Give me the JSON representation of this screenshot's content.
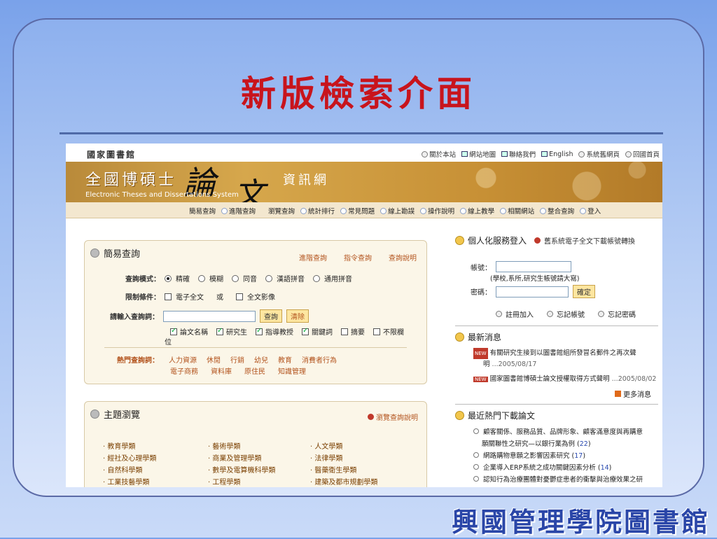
{
  "slide": {
    "title": "新版檢索介面",
    "footer_logo": "興國管理學院圖書館"
  },
  "site": {
    "library_name": "國家圖書館",
    "top_links": [
      "關於本站",
      "網站地圖",
      "聯絡我們",
      "English",
      "系統舊網頁",
      "回國首頁"
    ],
    "banner_title": "全國博碩士",
    "banner_big1": "論",
    "banner_big2": "文",
    "banner_sub": "資訊網",
    "banner_en": "Electronic Theses and Dissertations System",
    "nav": [
      "簡易查詢",
      "進階查詢",
      "瀏覽查詢",
      "統計排行",
      "常見問題",
      "線上勘誤",
      "操作說明",
      "線上教學",
      "相關網站",
      "整合查詢",
      "登入"
    ]
  },
  "simple_search": {
    "header": "簡易查詢",
    "links": [
      "進階查詢",
      "指令查詢",
      "查詢說明"
    ],
    "mode_label": "查詢模式：",
    "modes": [
      "精確",
      "模糊",
      "同音",
      "漢語拼音",
      "通用拼音"
    ],
    "limit_label": "限制條件：",
    "limit_opt1": "電子全文",
    "limit_or": "或",
    "limit_opt2": "全文影像",
    "input_label": "請輸入查詢詞：",
    "query_value": "",
    "search_btn": "查詢",
    "clear_btn": "清除",
    "fields": [
      "論文名稱",
      "研究生",
      "指導教授",
      "關鍵詞",
      "摘要",
      "不限欄"
    ],
    "fields_wrap": "位",
    "hot_label": "熱門查詢詞：",
    "hot_terms_row1": [
      "人力資源",
      "休閒",
      "行銷",
      "幼兒",
      "教育",
      "消費者行為"
    ],
    "hot_terms_row2": [
      "電子商務",
      "資料庫",
      "原住民",
      "知識管理"
    ]
  },
  "browse": {
    "header": "主題瀏覽",
    "help_link": "瀏覽查詢說明",
    "col1": [
      "教育學類",
      "經社及心理學類",
      "自然科學類",
      "工業技藝學類"
    ],
    "col2": [
      "藝術學類",
      "商業及管理學類",
      "數學及電算機科學類",
      "工程學類"
    ],
    "col3": [
      "人文學類",
      "法律學類",
      "醫藥衛生學類",
      "建築及都市規劃學類"
    ]
  },
  "login": {
    "header": "個人化服務登入",
    "old_link": "舊系統電子全文下載帳號轉換",
    "account_label": "帳號：",
    "account_value": "",
    "account_hint": "(學校,系所,研究生帳號請大寫)",
    "password_label": "密碼：",
    "password_value": "",
    "confirm_btn": "確定",
    "register": "註冊加入",
    "forgot_account": "忘記帳號",
    "forgot_password": "忘記密碼"
  },
  "news": {
    "header": "最新消息",
    "tag": "NEW",
    "item1a": "有關研究生接到以圖書館組所發冒名郵件之再次聲",
    "item1b": "明",
    "item1_date": "...2005/08/17",
    "item2": "國家圖書館博碩士論文授權取得方式聲明",
    "item2_date": "...2005/08/02",
    "more": "更多消息"
  },
  "hot_downloads": {
    "header": "最近熱門下載論文",
    "items": [
      {
        "title1": "顧客關係、服務品質、品牌形象、顧客滿意度與再購意",
        "title2": "願關聯性之研究—以銀行業為例",
        "count": "22"
      },
      {
        "title1": "網路購物意願之影響因素研究",
        "title2": "",
        "count": "17"
      },
      {
        "title1": "企業導入ERP系統之成功關鍵因素分析",
        "title2": "",
        "count": "14"
      },
      {
        "title1": "認知行為治療團體對憂鬱症患者的衝擊與治療效果之研",
        "title2": "",
        "count": ""
      }
    ]
  }
}
